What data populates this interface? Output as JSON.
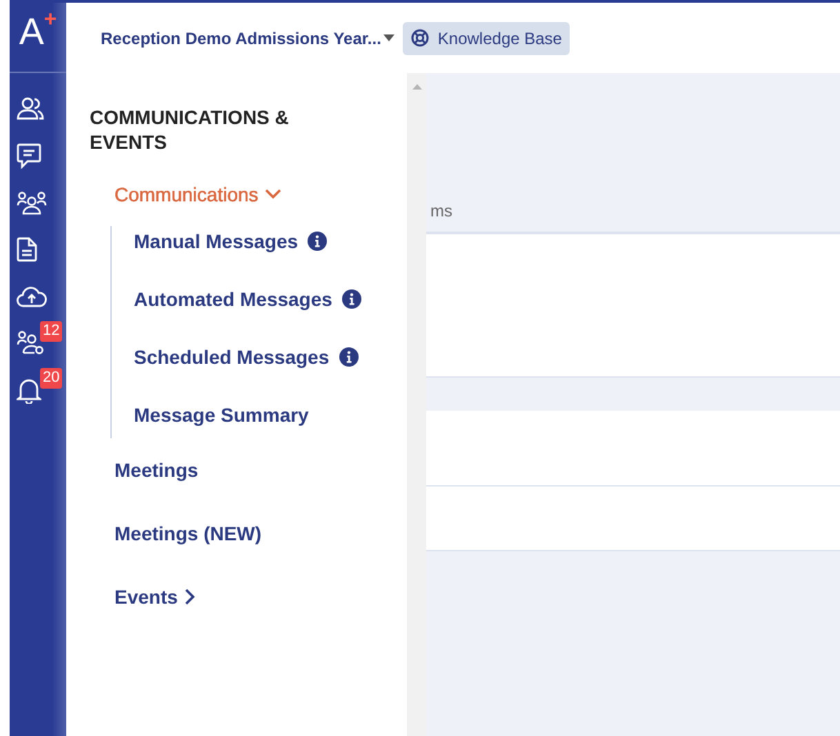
{
  "top_bar": {
    "program_selector": {
      "label": "Reception Demo Admissions Year..."
    },
    "knowledge_base": {
      "label": "Knowledge Base"
    }
  },
  "sidebar": {
    "logo": {
      "letter": "A",
      "mark": "+"
    },
    "items": [
      {
        "kind": "people"
      },
      {
        "kind": "chat"
      },
      {
        "kind": "group"
      },
      {
        "kind": "document"
      },
      {
        "kind": "upload"
      },
      {
        "kind": "people-gear",
        "badge": "12"
      },
      {
        "kind": "bell",
        "badge": "20"
      }
    ]
  },
  "menu": {
    "title": "COMMUNICATIONS & EVENTS",
    "items": [
      {
        "label": "Communications",
        "kind": "group",
        "expanded": true,
        "children": [
          {
            "label": "Manual Messages",
            "info": true
          },
          {
            "label": "Automated Messages",
            "info": true
          },
          {
            "label": "Scheduled Messages",
            "info": true
          },
          {
            "label": "Message Summary",
            "info": false
          }
        ]
      },
      {
        "label": "Meetings",
        "kind": "link"
      },
      {
        "label": "Meetings (NEW)",
        "kind": "link"
      },
      {
        "label": "Events",
        "kind": "group",
        "expanded": false
      }
    ]
  },
  "content": {
    "tab_fragment": "ms"
  }
}
